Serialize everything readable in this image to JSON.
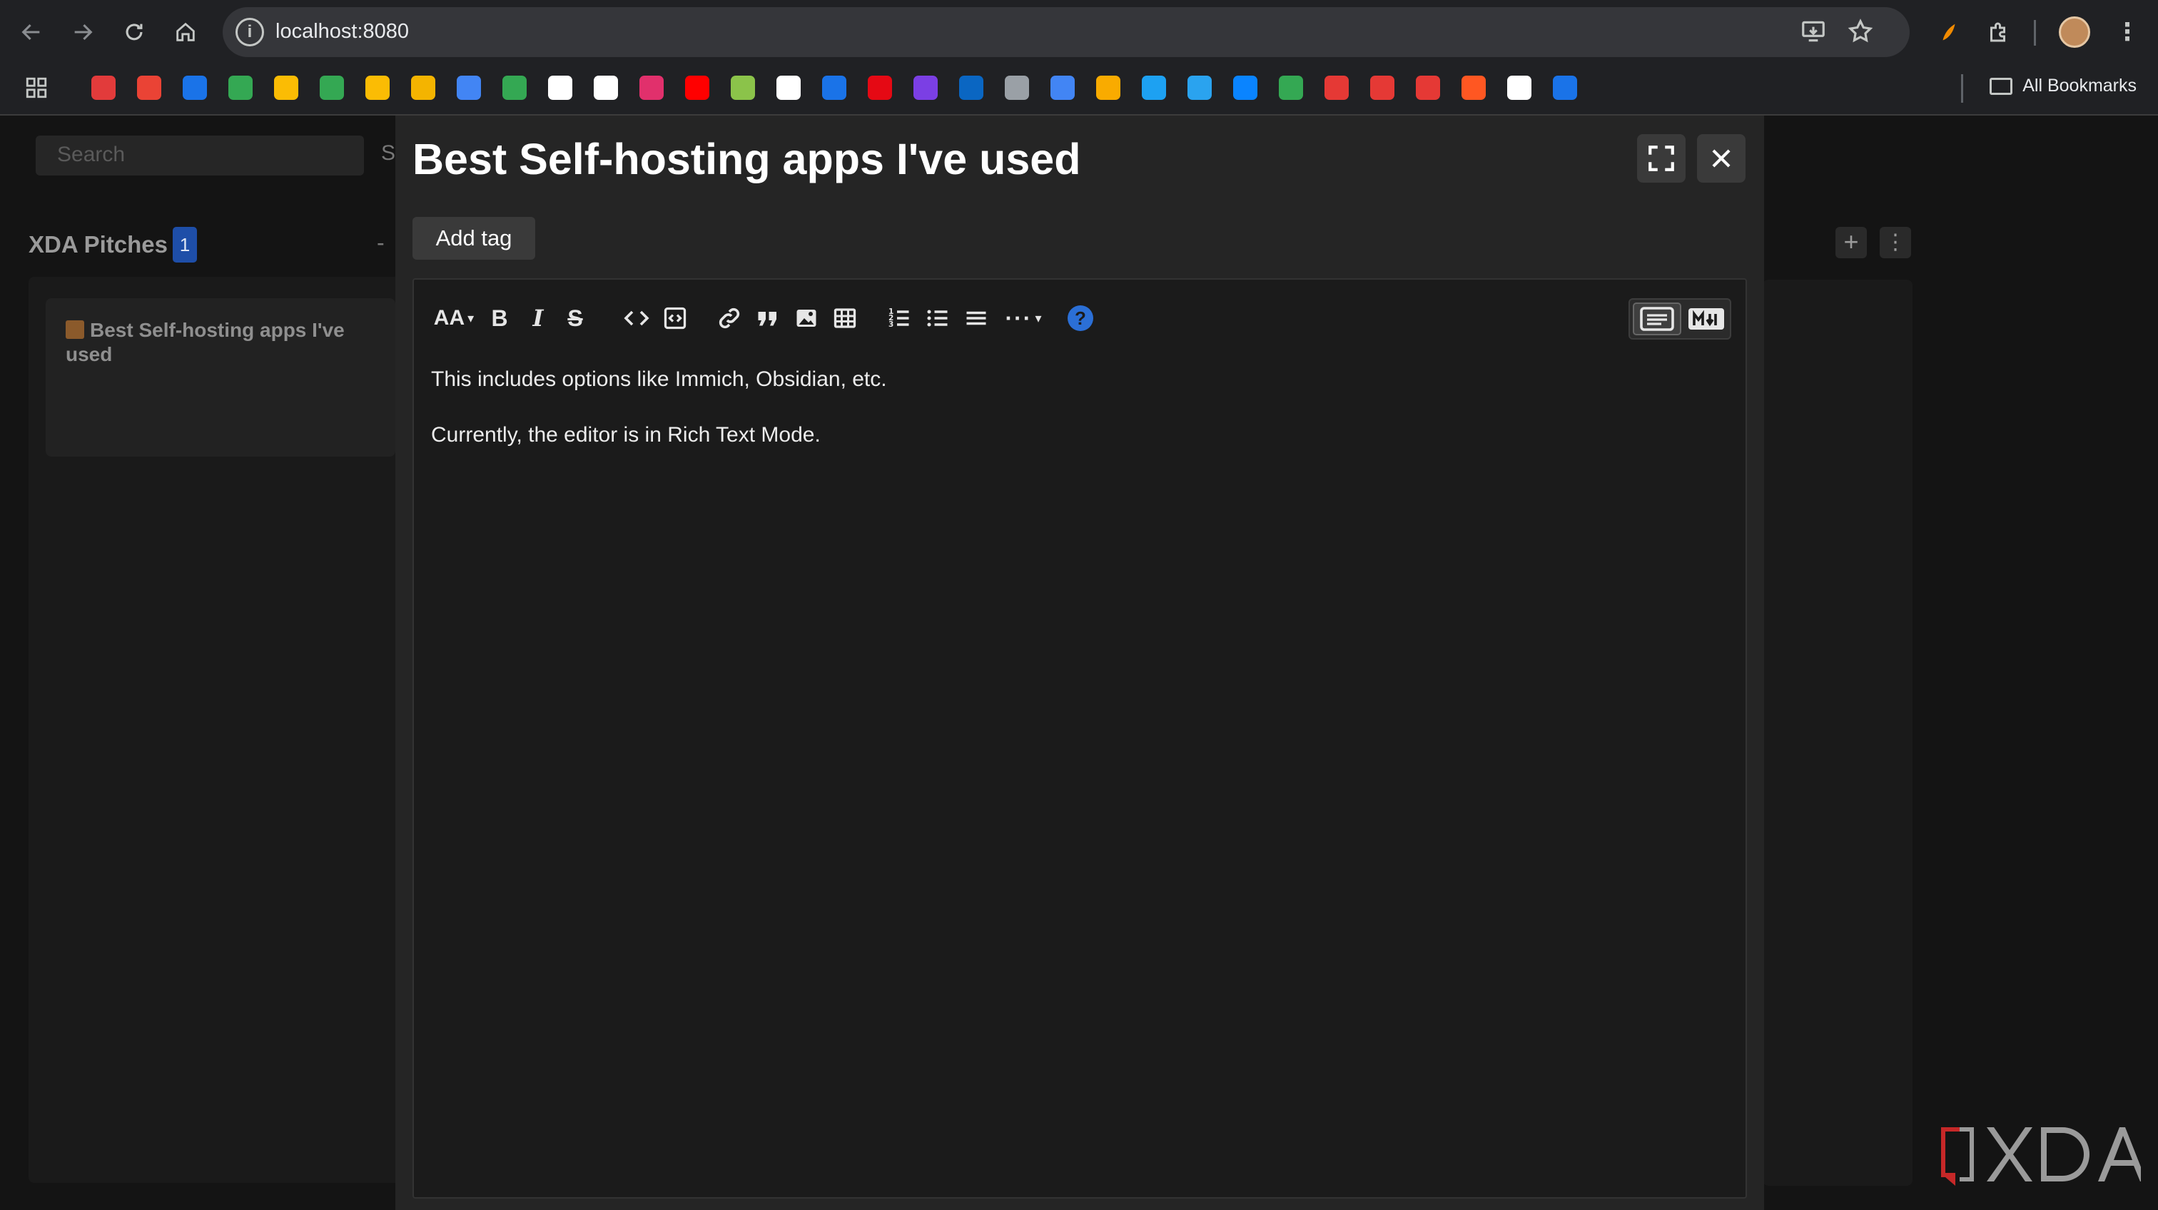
{
  "browser": {
    "url": "localhost:8080",
    "bookmarks_label": "All Bookmarks",
    "bookmark_icons": [
      "#e23b3b",
      "#ea4335",
      "#1a73e8",
      "#34a853",
      "#fbbc04",
      "#34a853",
      "#fbbc04",
      "#f4b400",
      "#4285f4",
      "#34a853",
      "#ffffff",
      "#ffffff",
      "#e1306c",
      "#ff0000",
      "#8bc34a",
      "#ffffff",
      "#1a73e8",
      "#e50914",
      "#7b3fe4",
      "#0a66c2",
      "#9aa0a6",
      "#4285f4",
      "#f9ab00",
      "#1da1f2",
      "#2aa3ef",
      "#0a84ff",
      "#34a853",
      "#e53935",
      "#e53935",
      "#e53935",
      "#ff5722",
      "#ffffff",
      "#1a73e8"
    ]
  },
  "app": {
    "search_placeholder": "Search",
    "search_after": "S",
    "column": {
      "title": "XDA Pitches",
      "count": "1",
      "minus": "-",
      "card_title": "Best Self-hosting apps I've used"
    }
  },
  "modal": {
    "title": "Best Self-hosting apps I've used",
    "add_tag": "Add tag",
    "toolbar": {
      "heading": "AA",
      "bold": "B",
      "italic": "I",
      "strike": "S",
      "help": "?"
    },
    "content": [
      "This includes options like Immich, Obsidian, etc.",
      "Currently, the editor is in Rich Text Mode."
    ]
  },
  "colors": {
    "accent": "#2b6fd6",
    "badge": "#1e4ea8",
    "background": "#141414"
  }
}
